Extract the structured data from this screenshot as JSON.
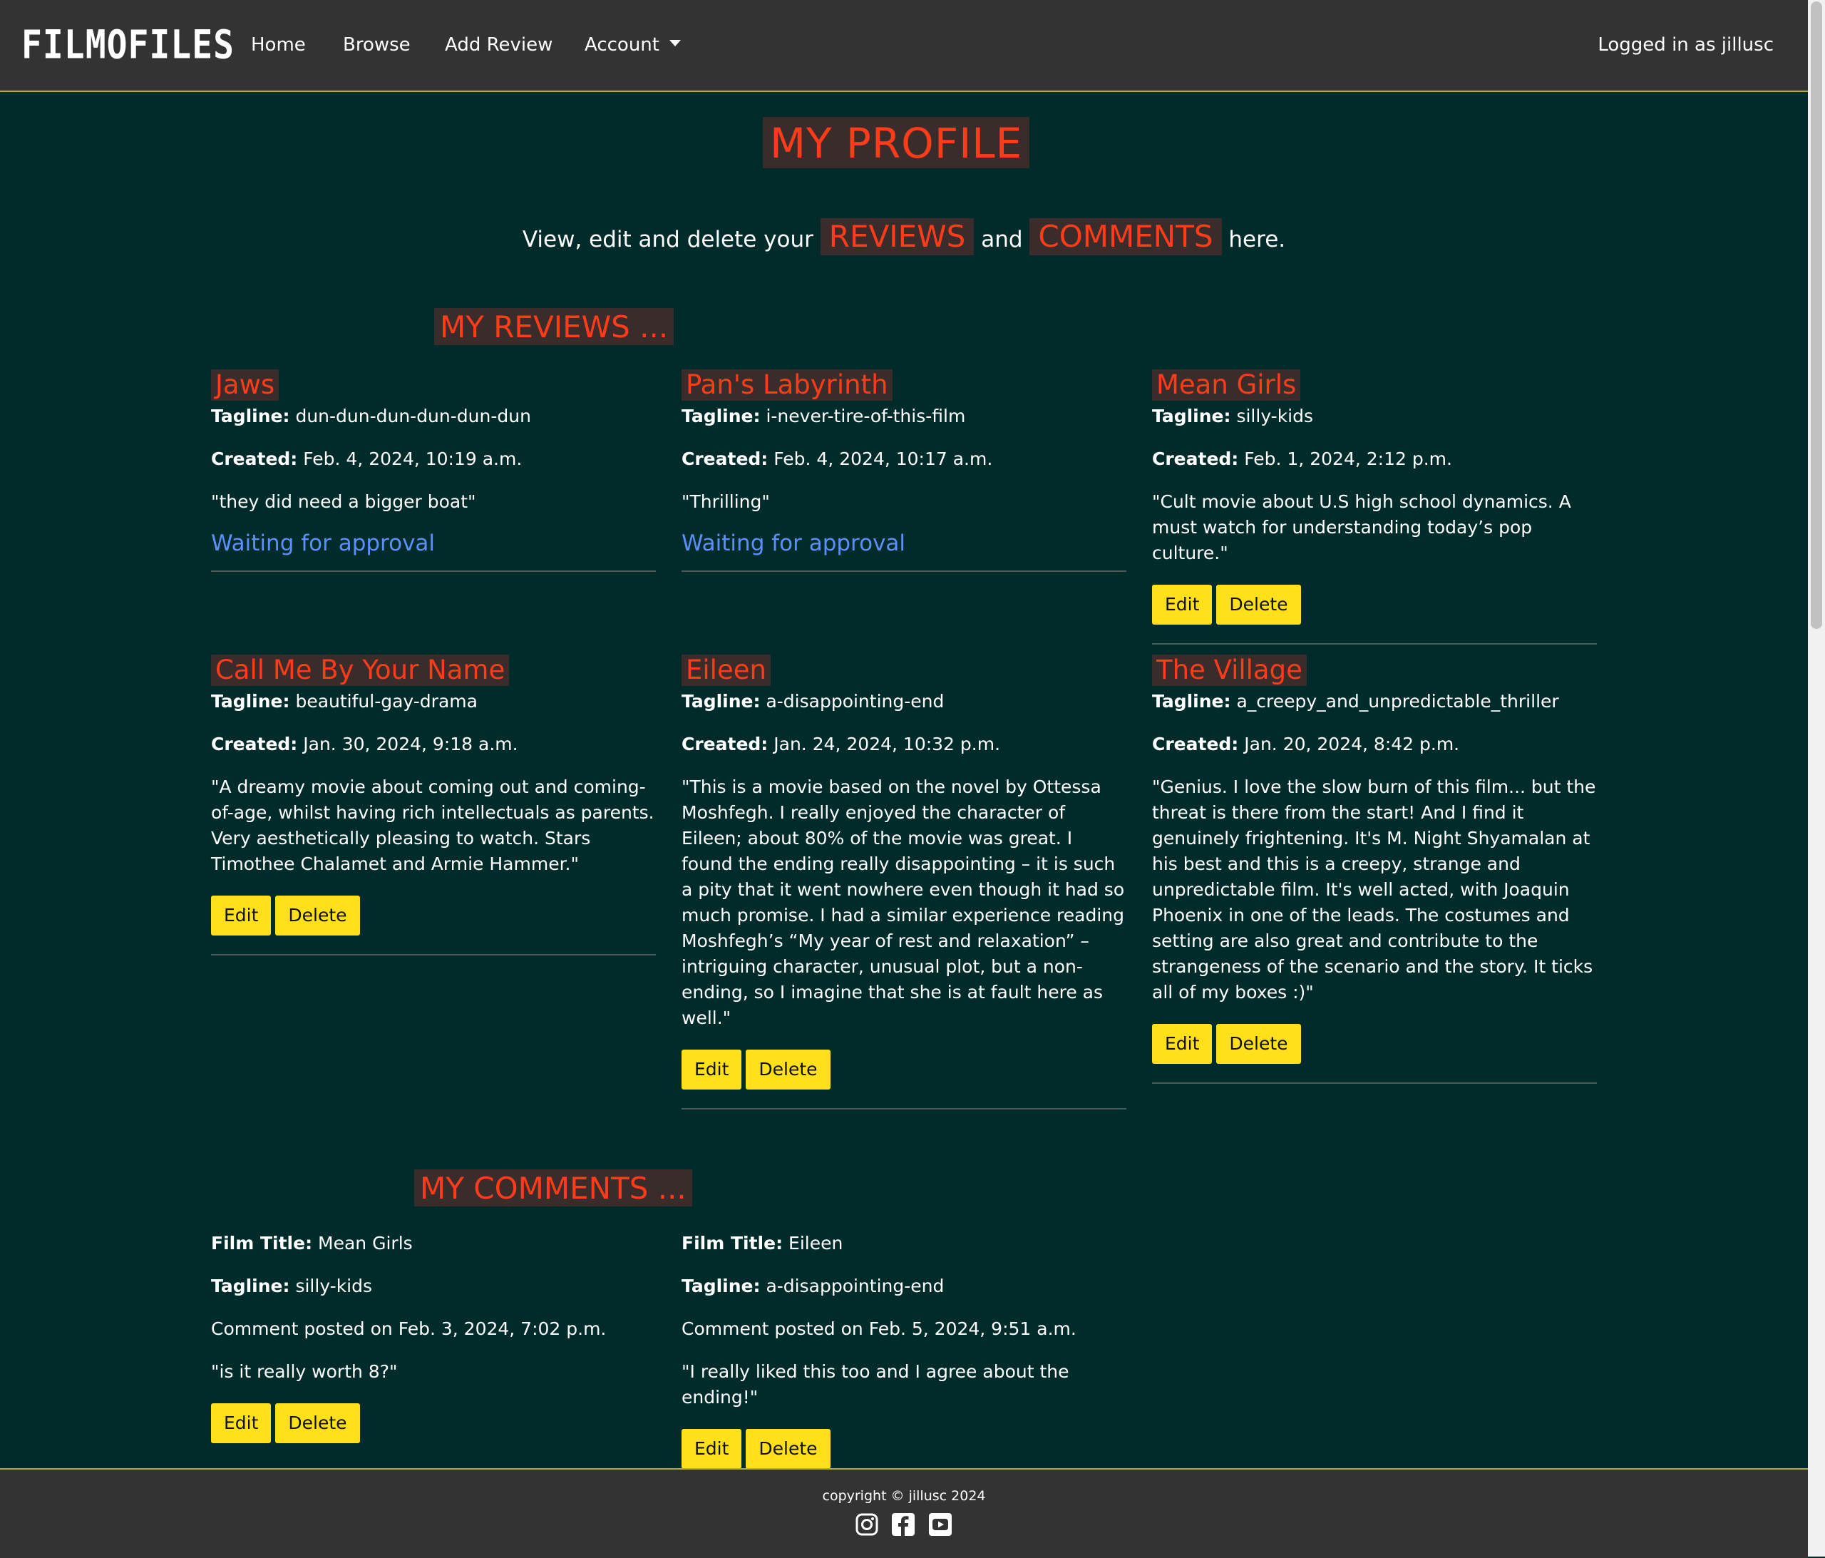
{
  "nav": {
    "brand": "FILMOFILES",
    "links": [
      "Home",
      "Browse",
      "Add Review",
      "Account"
    ],
    "logged_in": "Logged in as jillusc"
  },
  "page": {
    "title": "MY PROFILE",
    "subtitle_pre": "View, edit and delete your",
    "subtitle_reviews": "REVIEWS",
    "subtitle_and": "and",
    "subtitle_comments": "COMMENTS",
    "subtitle_post": "here."
  },
  "reviews_section": {
    "heading": "MY REVIEWS ...",
    "tagline_label": "Tagline:",
    "created_label": "Created:",
    "reviews": [
      {
        "title": "Jaws",
        "tagline": "dun-dun-dun-dun-dun-dun",
        "created": "Feb. 4, 2024, 10:19 a.m.",
        "text": "\"they did need a bigger boat\"",
        "status": "Waiting for approval"
      },
      {
        "title": "Pan's Labyrinth",
        "tagline": "i-never-tire-of-this-film",
        "created": "Feb. 4, 2024, 10:17 a.m.",
        "text": "\"Thrilling\"",
        "status": "Waiting for approval"
      },
      {
        "title": "Mean Girls",
        "tagline": "silly-kids",
        "created": "Feb. 1, 2024, 2:12 p.m.",
        "text": "\"Cult movie about U.S high school dynamics. A must watch for understanding today’s pop culture.\"",
        "edit": "Edit",
        "delete": "Delete"
      },
      {
        "title": "Call Me By Your Name",
        "tagline": "beautiful-gay-drama",
        "created": "Jan. 30, 2024, 9:18 a.m.",
        "text": "\"A dreamy movie about coming out and coming-of-age, whilst having rich intellectuals as parents. Very aesthetically pleasing to watch. Stars Timothee Chalamet and Armie Hammer.\"",
        "edit": "Edit",
        "delete": "Delete"
      },
      {
        "title": "Eileen",
        "tagline": "a-disappointing-end",
        "created": "Jan. 24, 2024, 10:32 p.m.",
        "text": "\"This is a movie based on the novel by Ottessa Moshfegh. I really enjoyed the character of Eileen; about 80% of the movie was great. I found the ending really disappointing – it is such a pity that it went nowhere even though it had so much promise. I had a similar experience reading Moshfegh’s “My year of rest and relaxation” – intriguing character, unusual plot, but a non-ending, so I imagine that she is at fault here as well.\"",
        "edit": "Edit",
        "delete": "Delete"
      },
      {
        "title": "The Village",
        "tagline": "a_creepy_and_unpredictable_thriller",
        "created": "Jan. 20, 2024, 8:42 p.m.",
        "text": "\"Genius. I love the slow burn of this film... but the threat is there from the start! And I find it genuinely frightening. It's M. Night Shyamalan at his best and this is a creepy, strange and unpredictable film. It's well acted, with Joaquin Phoenix in one of the leads. The costumes and setting are also great and contribute to the strangeness of the scenario and the story. It ticks all of my boxes :)\"",
        "edit": "Edit",
        "delete": "Delete"
      }
    ]
  },
  "comments_section": {
    "heading": "MY COMMENTS ...",
    "film_label": "Film Title:",
    "tagline_label": "Tagline:",
    "comments": [
      {
        "film": "Mean Girls",
        "tagline": "silly-kids",
        "posted": "Comment posted on Feb. 3, 2024, 7:02 p.m.",
        "text": "\"is it really worth 8?\"",
        "edit": "Edit",
        "delete": "Delete"
      },
      {
        "film": "Eileen",
        "tagline": "a-disappointing-end",
        "posted": "Comment posted on Feb. 5, 2024, 9:51 a.m.",
        "text": "\"I really liked this too and I agree about the ending!\"",
        "edit": "Edit",
        "delete": "Delete"
      }
    ]
  },
  "footer": {
    "copyright": "copyright © jillusc 2024",
    "icons": [
      "instagram-icon",
      "facebook-icon",
      "youtube-icon"
    ]
  },
  "colors": {
    "background": "#002b2b",
    "navbar": "#333333",
    "heading_text": "#ff3c1a",
    "heading_bg": "#3a2c2a",
    "button": "#ffe01a",
    "waiting_link": "#5b8ff9",
    "navbar_border": "#b5ad3a"
  }
}
